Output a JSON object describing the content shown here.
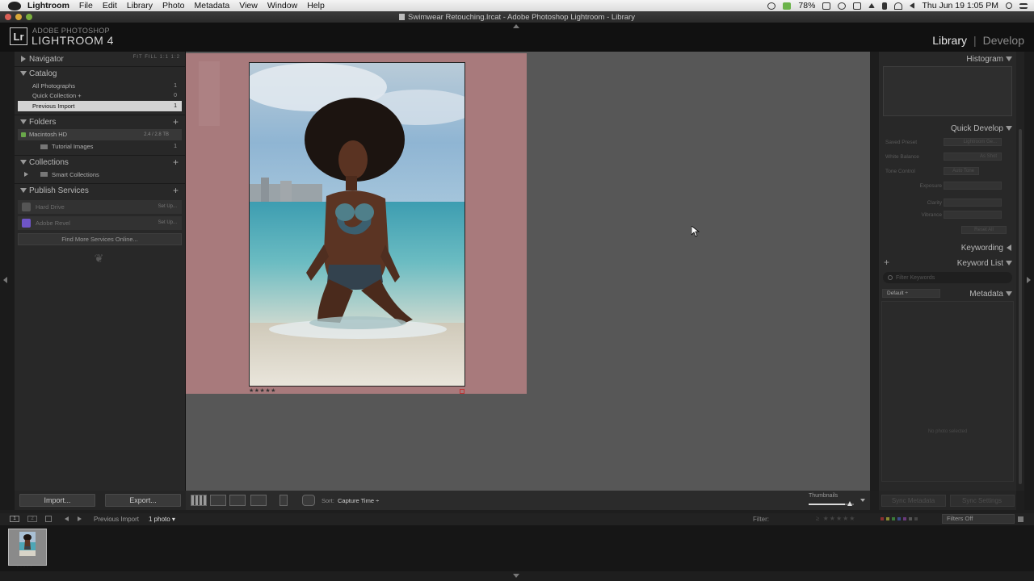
{
  "menubar": {
    "app": "Lightroom",
    "items": [
      "File",
      "Edit",
      "Library",
      "Photo",
      "Metadata",
      "View",
      "Window",
      "Help"
    ],
    "battery": "78%",
    "clock": "Thu Jun 19  1:05 PM"
  },
  "window": {
    "title": "Swimwear Retouching.lrcat - Adobe Photoshop Lightroom - Library"
  },
  "identity": {
    "badge": "Lr",
    "subtitle": "ADOBE PHOTOSHOP",
    "title": "LIGHTROOM 4",
    "modules": [
      "Library",
      "Develop"
    ],
    "separator": "|"
  },
  "left_panel": {
    "navigator": {
      "title": "Navigator",
      "options": "FIT  FILL  1:1  1:2"
    },
    "catalog": {
      "title": "Catalog",
      "items": [
        {
          "label": "All Photographs",
          "count": "1"
        },
        {
          "label": "Quick Collection +",
          "count": "0"
        },
        {
          "label": "Previous Import",
          "count": "1"
        }
      ]
    },
    "folders": {
      "title": "Folders",
      "plus": "+",
      "drive": {
        "label": "Macintosh HD",
        "size": "2.4 / 2.8 TB"
      },
      "items": [
        {
          "label": "Tutorial Images",
          "count": "1"
        }
      ]
    },
    "collections": {
      "title": "Collections",
      "plus": "+",
      "items": [
        {
          "label": "Smart Collections"
        }
      ]
    },
    "publish": {
      "title": "Publish Services",
      "plus": "+",
      "items": [
        {
          "label": "Hard Drive",
          "setup": "Set Up..."
        },
        {
          "label": "Adobe Revel",
          "setup": "Set Up..."
        }
      ],
      "find_more": "Find More Services Online..."
    },
    "ornament": "❦",
    "import_label": "Import...",
    "export_label": "Export..."
  },
  "grid": {
    "stars": "★★★★★"
  },
  "toolbar": {
    "sort_label": "Sort:",
    "sort_value": "Capture Time ÷",
    "thumbnails_label": "Thumbnails",
    "thumbnail_size": 0.8
  },
  "right_panel": {
    "histogram": "Histogram",
    "quick_develop": {
      "title": "Quick Develop",
      "rows": [
        {
          "label": "Saved Preset",
          "value": "Lightroom Ge..."
        },
        {
          "label": "White Balance",
          "value": "As Shot"
        },
        {
          "label": "Tone Control",
          "value": "Auto Tone"
        },
        {
          "label": "Exposure",
          "value": ""
        },
        {
          "label": "Clarity",
          "value": ""
        },
        {
          "label": "Vibrance",
          "value": ""
        }
      ],
      "reset": "Reset All"
    },
    "keywording": "Keywording",
    "keyword_list": {
      "title": "Keyword List",
      "plus": "+",
      "filter_placeholder": "Filter Keywords"
    },
    "metadata": {
      "title": "Metadata",
      "preset": "Default ÷",
      "empty": "No photo selected"
    },
    "sync_metadata": "Sync Metadata",
    "sync_settings": "Sync Settings"
  },
  "filmstrip": {
    "monitor1": "1",
    "monitor2": "2",
    "source": "Previous Import",
    "count": "1 photo ▾",
    "filter_label": "Filter:",
    "filter_stars": "≥ ★★★★★",
    "filter_value": "Filters Off",
    "thumb_dots": "• • • • •"
  }
}
